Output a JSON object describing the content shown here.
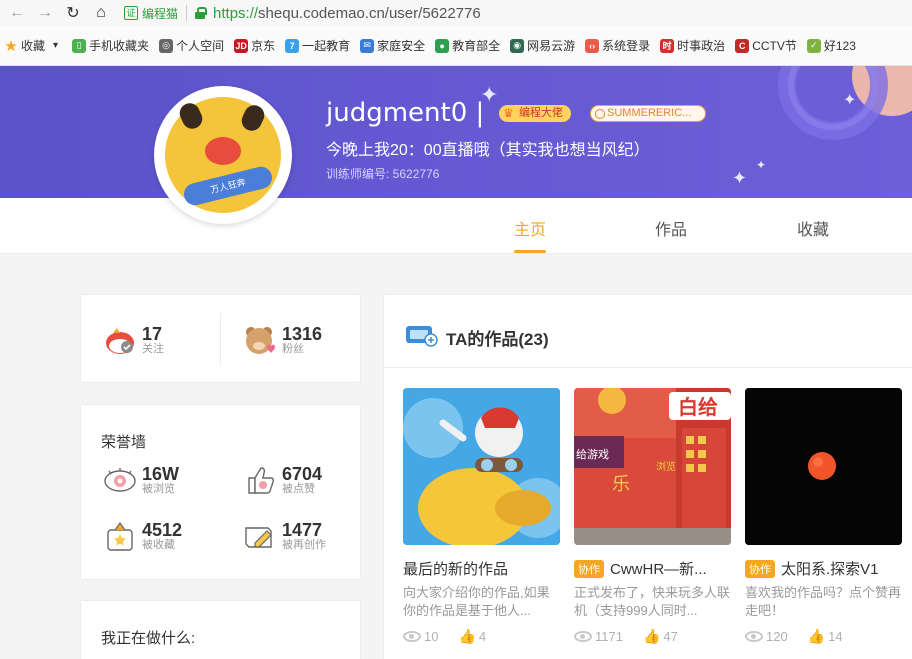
{
  "browser": {
    "url_protocol": "https://",
    "url_rest": "shequ.codemao.cn/user/5622776",
    "cert_label": "编程猫",
    "cert_icon": "证"
  },
  "bookmarks": [
    {
      "label": "收藏",
      "icon": "star-icon",
      "color": "#f5a623"
    },
    {
      "label": "手机收藏夹",
      "icon": "phone-icon",
      "color": "#4caf50"
    },
    {
      "label": "个人空间",
      "icon": "globe-icon",
      "color": "#666666"
    },
    {
      "label": "京东",
      "icon": "jd-icon",
      "color": "#c91623"
    },
    {
      "label": "一起教育",
      "icon": "yiqi-icon",
      "color": "#3aa0e8"
    },
    {
      "label": "家庭安全",
      "icon": "mail-icon",
      "color": "#3a7bd5"
    },
    {
      "label": "教育部全",
      "icon": "edu-icon",
      "color": "#2e9e4f"
    },
    {
      "label": "网易云游",
      "icon": "netease-icon",
      "color": "#2d6a4f"
    },
    {
      "label": "系统登录",
      "icon": "code-icon",
      "color": "#e85d4a"
    },
    {
      "label": "时事政治",
      "icon": "news-icon",
      "color": "#d32f2f"
    },
    {
      "label": "CCTV节",
      "icon": "cctv-icon",
      "color": "#c62828"
    },
    {
      "label": "好123",
      "icon": "hao123-icon",
      "color": "#7cb342"
    }
  ],
  "profile": {
    "username": "judgment0 |",
    "badge_level": "编程大佬",
    "badge_group": "SUMMERERIC...",
    "motto": "今晚上我20：00直播哦（其实我也想当风纪）",
    "trainer_id": "训练师编号: 5622776",
    "avatar_band_text": "万人狂奔",
    "colors": {
      "banner": "#5f56cd",
      "accent": "#f5a623"
    }
  },
  "tabs": [
    {
      "label": "主页",
      "active": true
    },
    {
      "label": "作品",
      "active": false
    },
    {
      "label": "收藏",
      "active": false
    }
  ],
  "follow": {
    "following_num": "17",
    "following_label": "关注",
    "fans_num": "1316",
    "fans_label": "粉丝"
  },
  "honor": {
    "title": "荣誉墙",
    "views_num": "16W",
    "views_label": "被浏览",
    "likes_num": "6704",
    "likes_label": "被点赞",
    "collects_num": "4512",
    "collects_label": "被收藏",
    "remix_num": "1477",
    "remix_label": "被再创作"
  },
  "doing": {
    "title": "我正在做什么:"
  },
  "works": {
    "header": "TA的作品(23)",
    "items": [
      {
        "collab": "",
        "title": "最后的新的作品",
        "desc": "向大家介绍你的作品,如果你的作品是基于他人...",
        "views": "10",
        "likes": "4"
      },
      {
        "collab": "协作",
        "title": "CwwHR—新...",
        "desc": "正式发布了，快来玩多人联机（支持999人同时...",
        "views": "1171",
        "likes": "47"
      },
      {
        "collab": "协作",
        "title": "太阳系.探索V1",
        "desc": "喜欢我的作品吗？点个赞再走吧！",
        "views": "120",
        "likes": "14"
      }
    ],
    "thumb2_texts": {
      "top": "白给",
      "left": "给游戏",
      "mid": "乐",
      "side": "浏览"
    }
  }
}
